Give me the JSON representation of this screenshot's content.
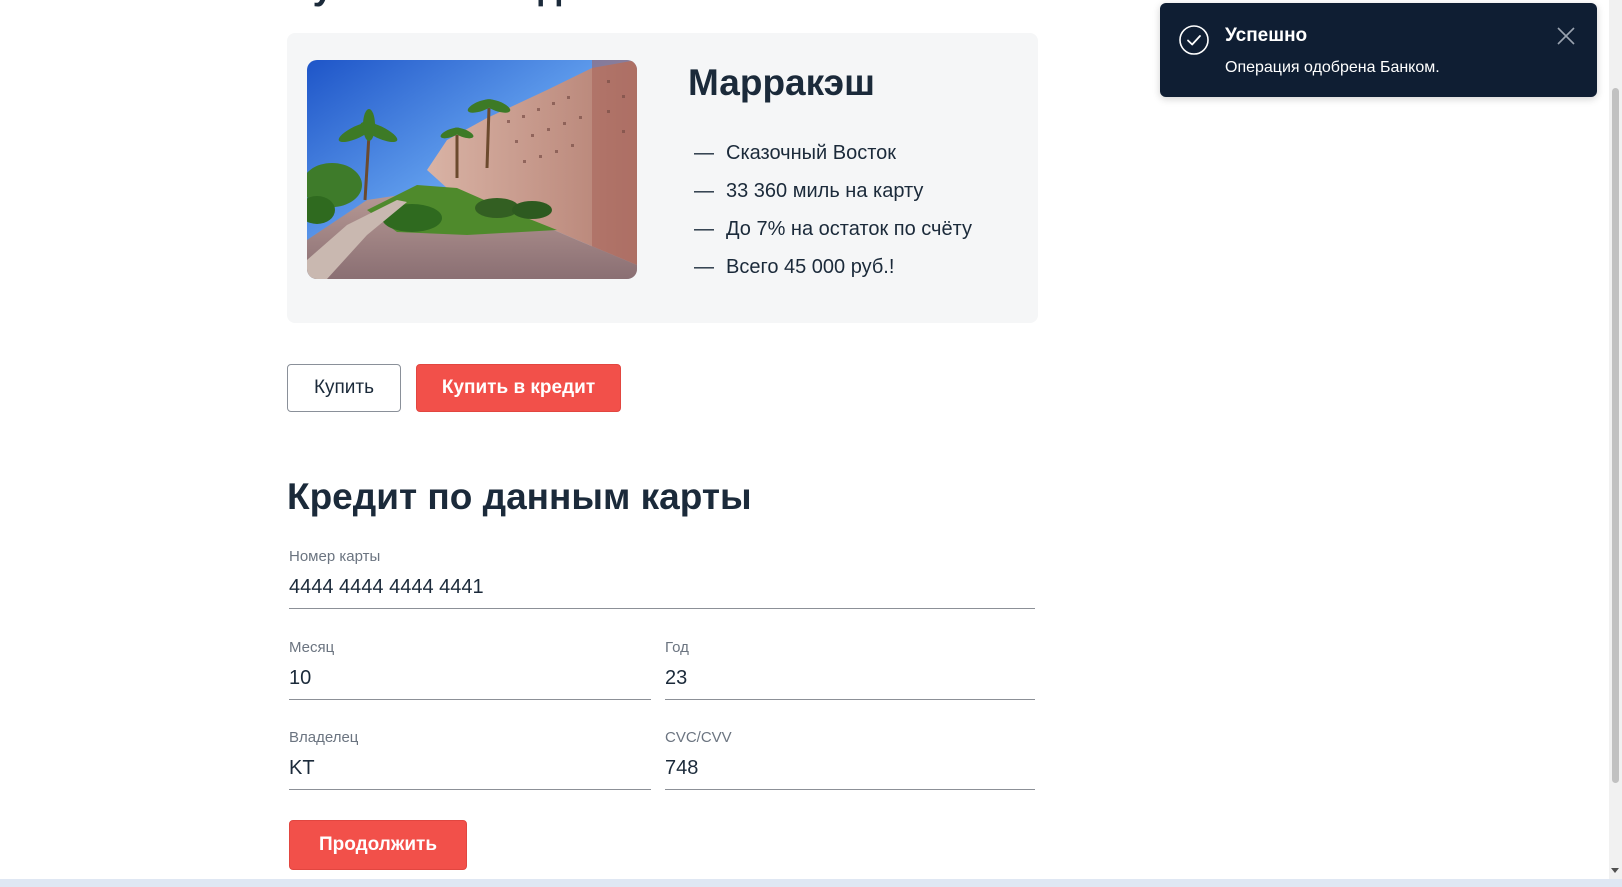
{
  "page": {
    "cut_title": "Путешествие дня",
    "offer": {
      "title": "Марракэш",
      "features": [
        "Сказочный Восток",
        "33 360 миль на карту",
        "До 7% на остаток по счёту",
        "Всего 45 000 руб.!"
      ],
      "feature_dash": "—"
    },
    "buttons": {
      "buy": "Купить",
      "buy_credit": "Купить в кредит"
    },
    "form": {
      "title": "Кредит по данным карты",
      "card_number_label": "Номер карты",
      "card_number_value": "4444 4444 4444 4441",
      "month_label": "Месяц",
      "month_value": "10",
      "year_label": "Год",
      "year_value": "23",
      "owner_label": "Владелец",
      "owner_value": "KT",
      "cvc_label": "CVC/CVV",
      "cvc_value": "748",
      "continue_label": "Продолжить"
    }
  },
  "toast": {
    "title": "Успешно",
    "message": "Операция одобрена Банком.",
    "icon": "check-circle-icon",
    "close_icon": "close-icon"
  },
  "colors": {
    "accent_red": "#f2504a",
    "text_dark": "#1b2a3a",
    "toast_bg": "#0f1e33",
    "card_bg": "#f5f6f7"
  }
}
